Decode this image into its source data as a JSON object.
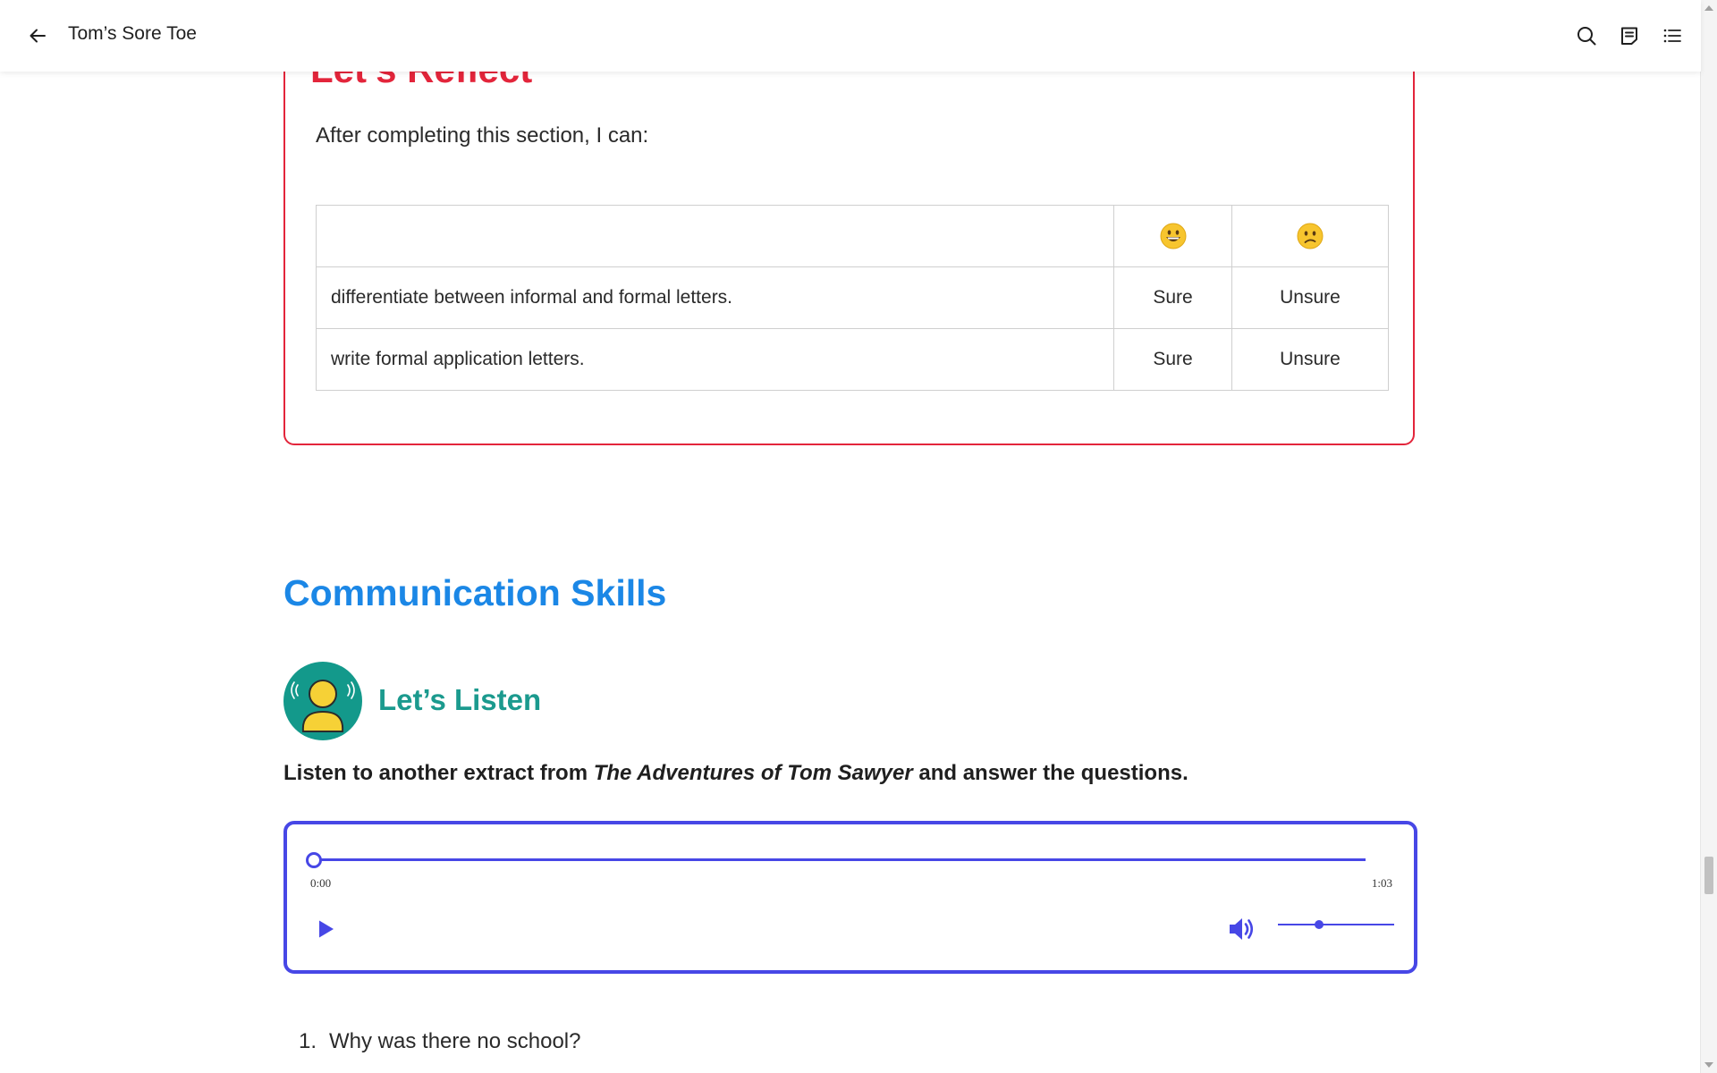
{
  "header": {
    "title": "Tom’s Sore Toe"
  },
  "self_check": {
    "heading": "Let’s Reflect",
    "intro": "After completing this section, I can:",
    "rows": [
      {
        "text": "differentiate between informal and formal letters.",
        "sure": "Sure",
        "unsure": "Unsure"
      },
      {
        "text": "write formal application letters.",
        "sure": "Sure",
        "unsure": "Unsure"
      }
    ]
  },
  "main": {
    "section_heading": "Communication Skills",
    "listen_heading": "Let’s Listen",
    "instruction_before": "Listen to another extract from ",
    "instruction_title": "The Adventures of Tom Sawyer",
    "instruction_after": " and answer the questions."
  },
  "audio": {
    "current_time": "0:00",
    "total_time": "1:03",
    "progress": 0,
    "volume": 0.35
  },
  "questions": [
    {
      "number": "1.",
      "text": "Why was there no school?"
    }
  ],
  "colors": {
    "reflect_red": "#e3253b",
    "heading_blue": "#1b87e6",
    "listen_teal": "#1b9a8e",
    "player_accent": "#4747e6"
  }
}
